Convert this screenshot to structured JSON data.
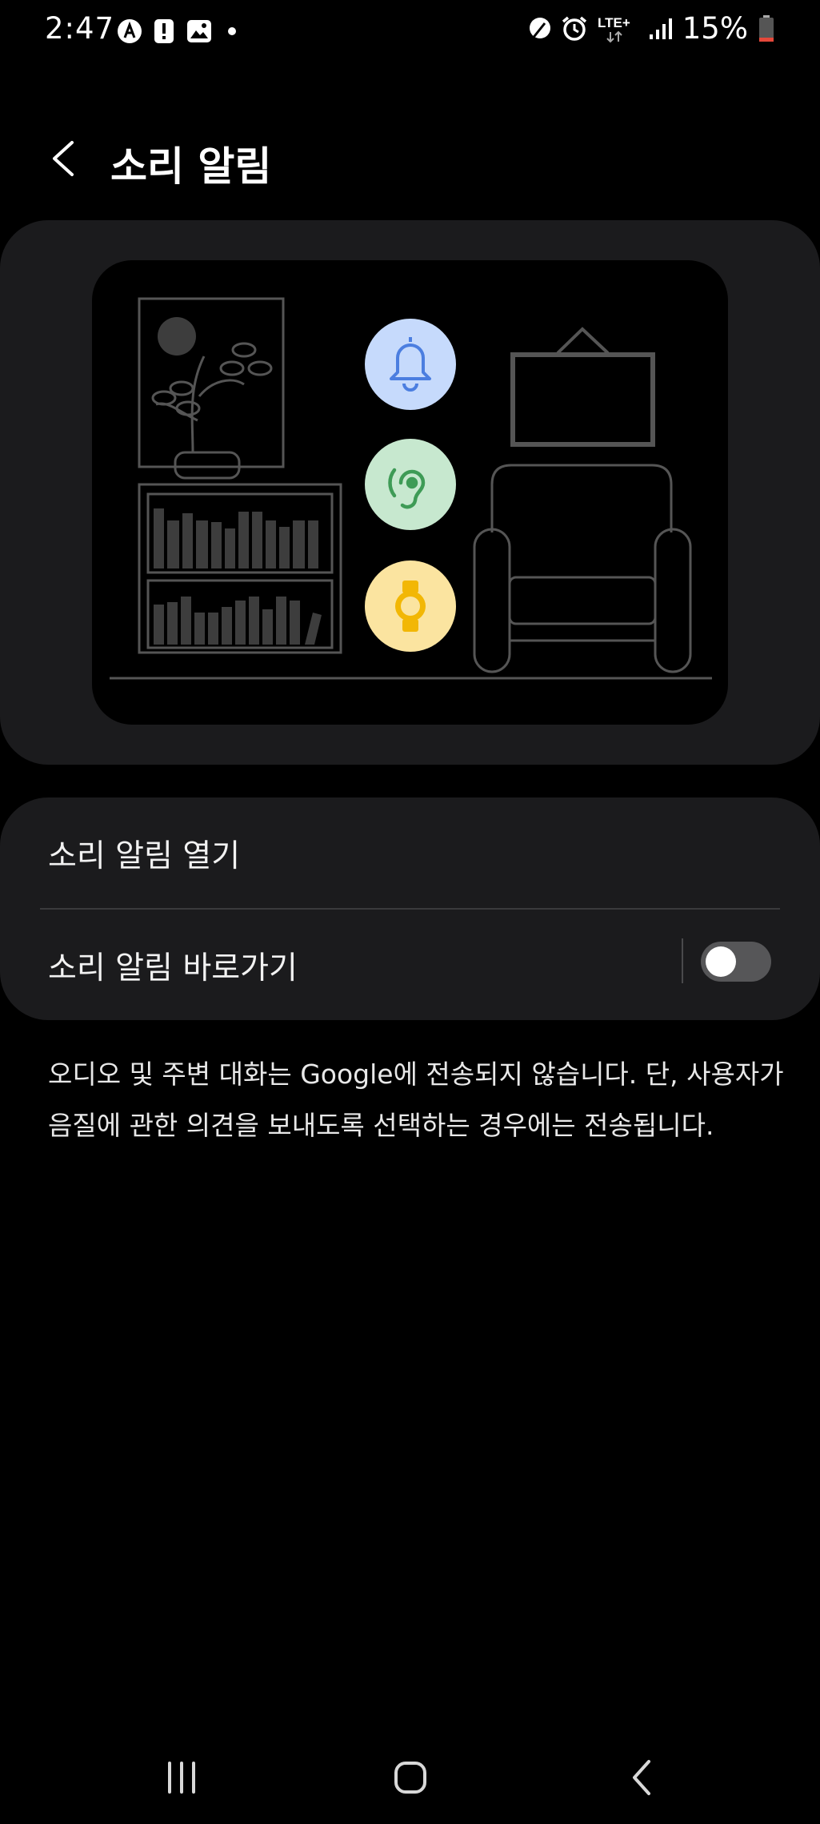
{
  "status_bar": {
    "time": "2:47",
    "left_icons": [
      "accessibility-a-icon",
      "alert-icon",
      "gallery-icon",
      "dot-icon"
    ],
    "right_icons": [
      "leaf-icon",
      "alarm-icon",
      "lte-icon",
      "signal-icon"
    ],
    "network": "LTE+",
    "battery_percent": "15%",
    "battery_level": 0.15
  },
  "header": {
    "title": "소리 알림",
    "back_icon": "back-chevron-icon"
  },
  "illustration": {
    "icons": [
      "bell-icon",
      "ear-icon",
      "watch-icon"
    ],
    "colors": {
      "bell_bg": "#c6dafc",
      "bell_fg": "#4b7ee0",
      "ear_bg": "#c7e8cf",
      "ear_fg": "#3e9b56",
      "watch_bg": "#fbe4a0",
      "watch_fg": "#f2b705",
      "line": "#555555"
    }
  },
  "settings": {
    "open_label": "소리 알림 열기",
    "shortcut_label": "소리 알림 바로가기",
    "shortcut_enabled": false
  },
  "description": {
    "line1": "오디오 및 주변 대화는 Google에 전송되지 않습니다. 단, 사용자가",
    "line2": "음질에 관한 의견을 보내도록 선택하는 경우에는 전송됩니다."
  },
  "nav": {
    "icons": [
      "recent-apps-icon",
      "home-icon",
      "back-icon"
    ]
  }
}
